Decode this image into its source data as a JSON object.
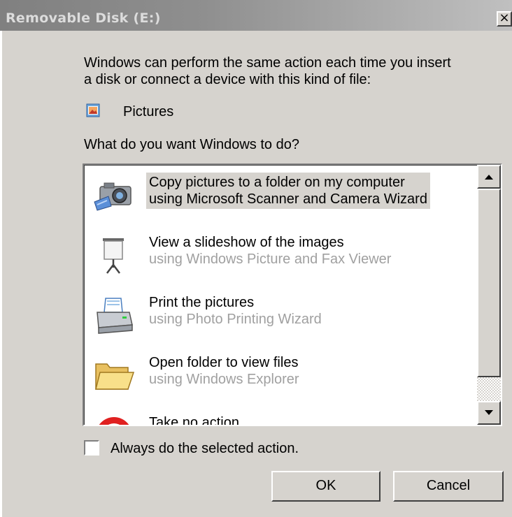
{
  "window": {
    "title": "Removable Disk (E:)",
    "close_glyph": "×"
  },
  "intro": {
    "line1": "Windows can perform the same action each time you insert",
    "line2": "a disk or connect a device with this kind of file:"
  },
  "content_type": {
    "icon": "pictures-icon",
    "label": "Pictures"
  },
  "question": "What do you want Windows to do?",
  "actions": [
    {
      "icon": "camera-icon",
      "title": "Copy pictures to a folder on my computer",
      "subtitle": "using Microsoft Scanner and Camera Wizard",
      "selected": true
    },
    {
      "icon": "projector-screen-icon",
      "title": "View a slideshow of the images",
      "subtitle": "using Windows Picture and Fax Viewer",
      "selected": false
    },
    {
      "icon": "printer-icon",
      "title": "Print the pictures",
      "subtitle": "using Photo Printing Wizard",
      "selected": false
    },
    {
      "icon": "folder-icon",
      "title": "Open folder to view files",
      "subtitle": "using Windows Explorer",
      "selected": false
    },
    {
      "icon": "no-action-icon",
      "title": "Take no action",
      "subtitle": "",
      "selected": false
    }
  ],
  "always_checkbox": {
    "label": "Always do the selected action.",
    "checked": false
  },
  "buttons": {
    "ok": "OK",
    "cancel": "Cancel"
  },
  "colors": {
    "face": "#d6d3ce",
    "selection": "#d6d3ce",
    "subtitle_gray": "#a0a0a0"
  }
}
